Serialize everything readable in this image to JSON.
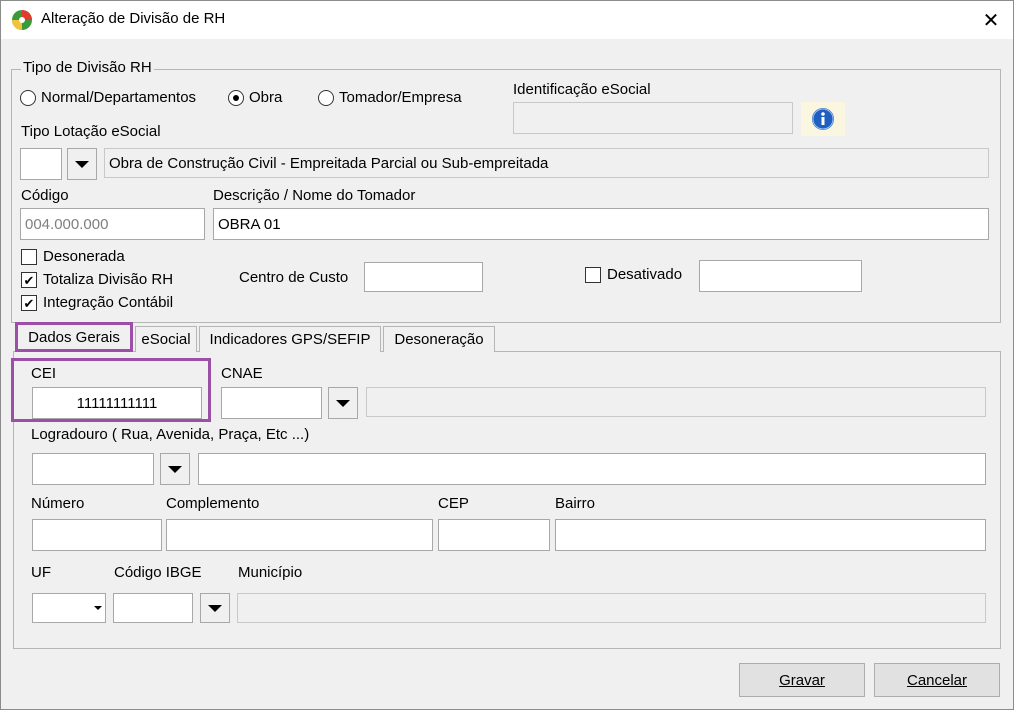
{
  "window": {
    "title": "Alteração de Divisão de RH",
    "close_glyph": "✕"
  },
  "tipo_divisao": {
    "legend": "Tipo de Divisão RH",
    "options": [
      "Normal/Departamentos",
      "Obra",
      "Tomador/Empresa"
    ],
    "selected": "Obra"
  },
  "identificacao": {
    "label": "Identificação eSocial",
    "value": ""
  },
  "tipo_lotacao": {
    "label": "Tipo Lotação eSocial",
    "code": "",
    "description": "Obra de Construção Civil - Empreitada Parcial ou Sub-empreitada"
  },
  "codigo": {
    "label": "Código",
    "value": "004.000.000"
  },
  "descricao": {
    "label": "Descrição / Nome do Tomador",
    "value": "OBRA 01"
  },
  "checks": {
    "desonerada": {
      "label": "Desonerada",
      "checked": false
    },
    "totaliza": {
      "label": "Totaliza Divisão RH",
      "checked": true
    },
    "integracao": {
      "label": "Integração Contábil",
      "checked": true
    },
    "desativado": {
      "label": "Desativado",
      "checked": false
    },
    "check_glyph": "✔"
  },
  "centro_custo": {
    "label": "Centro de Custo",
    "value": ""
  },
  "desativado_field": {
    "value": ""
  },
  "tabs": [
    {
      "label": "Dados Gerais",
      "active": true
    },
    {
      "label": "eSocial",
      "active": false
    },
    {
      "label": "Indicadores GPS/SEFIP",
      "active": false
    },
    {
      "label": "Desoneração",
      "active": false
    }
  ],
  "dados_gerais": {
    "cei": {
      "label": "CEI",
      "value": "11111111111"
    },
    "cnae": {
      "label": "CNAE",
      "value": "",
      "description": ""
    },
    "logradouro": {
      "label": "Logradouro ( Rua, Avenida, Praça, Etc ...)",
      "type": "",
      "value": ""
    },
    "numero": {
      "label": "Número",
      "value": ""
    },
    "complemento": {
      "label": "Complemento",
      "value": ""
    },
    "cep": {
      "label": "CEP",
      "value": ""
    },
    "bairro": {
      "label": "Bairro",
      "value": ""
    },
    "uf": {
      "label": "UF",
      "value": ""
    },
    "codigo_ibge": {
      "label": "Código IBGE",
      "value": ""
    },
    "municipio": {
      "label": "Município",
      "value": ""
    }
  },
  "buttons": {
    "gravar": "Gravar",
    "cancelar": "Cancelar"
  },
  "colors": {
    "highlight": "#9b4fa6",
    "info_blue": "#1f5fbf"
  }
}
